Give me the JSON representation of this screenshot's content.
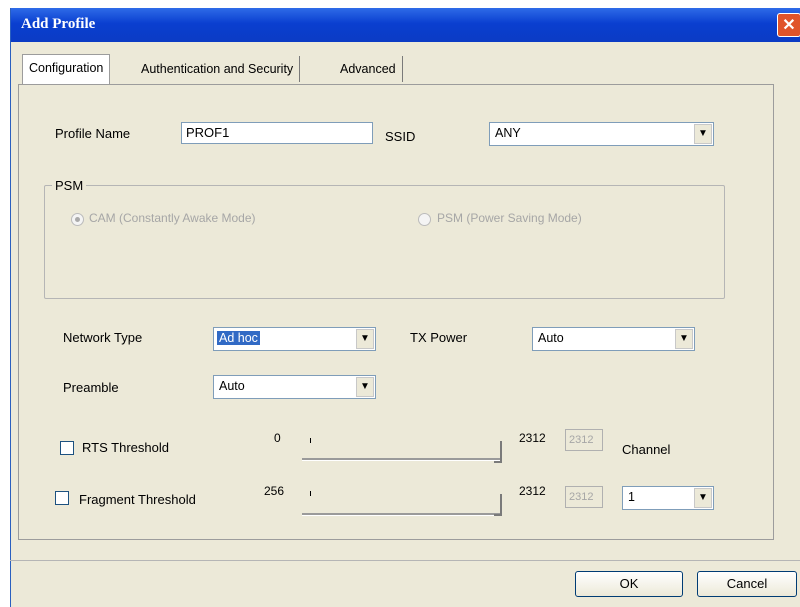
{
  "window": {
    "title": "Add Profile",
    "close_glyph": "✕"
  },
  "tabs": [
    {
      "label": "Configuration"
    },
    {
      "label": "Authentication and Security"
    },
    {
      "label": "Advanced"
    }
  ],
  "profile": {
    "label": "Profile Name",
    "value": "PROF1"
  },
  "ssid": {
    "label": "SSID",
    "value": "ANY"
  },
  "psm": {
    "group_label": "PSM",
    "cam_label": "CAM (Constantly Awake Mode)",
    "psm_label": "PSM (Power Saving Mode)",
    "selected": "CAM"
  },
  "network_type": {
    "label": "Network Type",
    "value": "Ad hoc"
  },
  "tx_power": {
    "label": "TX Power",
    "value": "Auto"
  },
  "preamble": {
    "label": "Preamble",
    "value": "Auto"
  },
  "rts": {
    "label": "RTS Threshold",
    "checked": false,
    "min": "0",
    "max": "2312",
    "value": "2312"
  },
  "fragment": {
    "label": "Fragment Threshold",
    "checked": false,
    "min": "256",
    "max": "2312",
    "value": "2312"
  },
  "channel": {
    "label": "Channel",
    "value": "1"
  },
  "buttons": {
    "ok": "OK",
    "cancel": "Cancel"
  },
  "icons": {
    "dropdown": "chevron-down-icon",
    "close": "close-icon"
  },
  "colors": {
    "titlebar": "#0a3fd0",
    "dialog_bg": "#ece9d8",
    "selection": "#316ac5",
    "close": "#e0542b"
  }
}
